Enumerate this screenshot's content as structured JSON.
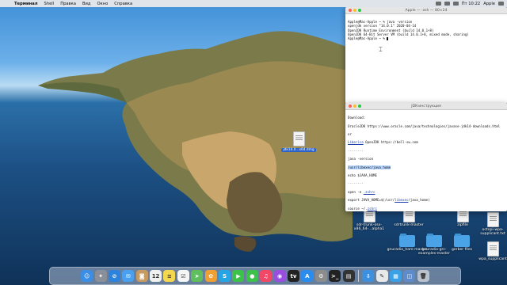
{
  "menubar": {
    "apple_glyph": "",
    "items": [
      "Терминал",
      "Shell",
      "Правка",
      "Вид",
      "Окно",
      "Справка"
    ],
    "clock": "Пт 10:22",
    "user": "Apple"
  },
  "terminal": {
    "title": "Apple — -zsh — 80×24",
    "lines": [
      "Apple@Mac-Apple ~ % java -version",
      "openjdk version \"14.0.1\" 2020-04-14",
      "OpenJDK Runtime Environment (build 14.0.1+8)",
      "OpenJDK 64-Bit Server VM (build 14.0.1+8, mixed mode, sharing)"
    ],
    "prompt": "Apple@Mac-Apple ~ % "
  },
  "editor": {
    "title": "JDK-инструкция",
    "download_label": "Download:",
    "oracle_line": "OracleJDK https://www.oracle.com/java/technologies/javase-jdk14-downloads.html",
    "or_label": "or",
    "liberica_word": "Liberica",
    "liberica_rest": " OpenJDK https://bell-sw.com",
    "separator": "--------",
    "java_version": "java -version",
    "java_home": "/usr/libexec/java_home",
    "echo_line": "echo $JAVA_HOME",
    "separator2": "--------",
    "open_prefix": "open -e ",
    "zshrc": ".zshrc",
    "export_prefix": "export JAVA_HOME=$(/usr/",
    "export_libexec": "libexec",
    "export_suffix": "/java_home)",
    "source_prefix": "source ~/.",
    "source_zshrc": "zshrc"
  },
  "dragged_file": {
    "label": "jdk14.0...x64.dmg"
  },
  "desktop_icons": [
    {
      "name": "sdr-trunk-x64",
      "label": "sdr-trunk-osx-x86_64-...alpha1",
      "kind": "doc"
    },
    {
      "name": "sdr-trunk-master",
      "label": "sdrtrunk-master",
      "kind": "doc"
    },
    {
      "name": "gnuradio-ham-master",
      "label": "gnuradio_ham-master",
      "kind": "folder"
    },
    {
      "name": "gnuradio-grc-examples",
      "label": "gnuradio-grc-examples-master",
      "kind": "folder"
    },
    {
      "name": "gerber-files",
      "label": "gerber files",
      "kind": "folder"
    },
    {
      "name": "octopi-supplicant",
      "label": "octopi-wpa-supplicant.txt",
      "kind": "doc"
    },
    {
      "name": "wpa-supplicant",
      "label": "wpa_supplicant",
      "kind": "doc"
    },
    {
      "name": "zipfile",
      "label": "zipfile",
      "kind": "doc"
    }
  ],
  "dock": {
    "apps": [
      {
        "name": "finder",
        "glyph": "☺",
        "color": "#3a8ee6"
      },
      {
        "name": "launchpad",
        "glyph": "✦",
        "color": "#8a8f99"
      },
      {
        "name": "safari",
        "glyph": "⊘",
        "color": "#2c83de"
      },
      {
        "name": "mail",
        "glyph": "✉",
        "color": "#4aa0f0"
      },
      {
        "name": "contacts",
        "glyph": "◙",
        "color": "#c79a62"
      },
      {
        "name": "calendar",
        "glyph": "12",
        "color": "#f0f0f0"
      },
      {
        "name": "notes",
        "glyph": "≡",
        "color": "#f4d74f"
      },
      {
        "name": "reminders",
        "glyph": "☑",
        "color": "#f6f6f6"
      },
      {
        "name": "maps",
        "glyph": "➤",
        "color": "#5fbf5f"
      },
      {
        "name": "photos",
        "glyph": "✿",
        "color": "#f0a030"
      },
      {
        "name": "skype",
        "glyph": "S",
        "color": "#25a5e6"
      },
      {
        "name": "facetime",
        "glyph": "▶",
        "color": "#3cc24b"
      },
      {
        "name": "messages",
        "glyph": "●",
        "color": "#3cc24b"
      },
      {
        "name": "music",
        "glyph": "♫",
        "color": "#f24766"
      },
      {
        "name": "podcasts",
        "glyph": "◉",
        "color": "#9a4ee0"
      },
      {
        "name": "tv",
        "glyph": "tv",
        "color": "#222222"
      },
      {
        "name": "app-store",
        "glyph": "A",
        "color": "#2b8cf0"
      },
      {
        "name": "system-preferences",
        "glyph": "⚙",
        "color": "#8c8c8c"
      },
      {
        "name": "terminal",
        "glyph": ">_",
        "color": "#222222"
      },
      {
        "name": "activity-monitor",
        "glyph": "▤",
        "color": "#333333"
      },
      {
        "name": "downloads",
        "glyph": "⇩",
        "color": "#3d8fe0"
      },
      {
        "name": "text-edit",
        "glyph": "✎",
        "color": "#e8e8e8"
      },
      {
        "name": "gallery",
        "glyph": "▦",
        "color": "#3aa0e8"
      },
      {
        "name": "preview",
        "glyph": "◫",
        "color": "#5e8bc9"
      },
      {
        "name": "trash",
        "glyph": "🗑",
        "color": "#b9c2cc"
      }
    ]
  },
  "colors": {
    "close": "#fe5f57",
    "minimize": "#febc2e",
    "zoom": "#28c840"
  }
}
